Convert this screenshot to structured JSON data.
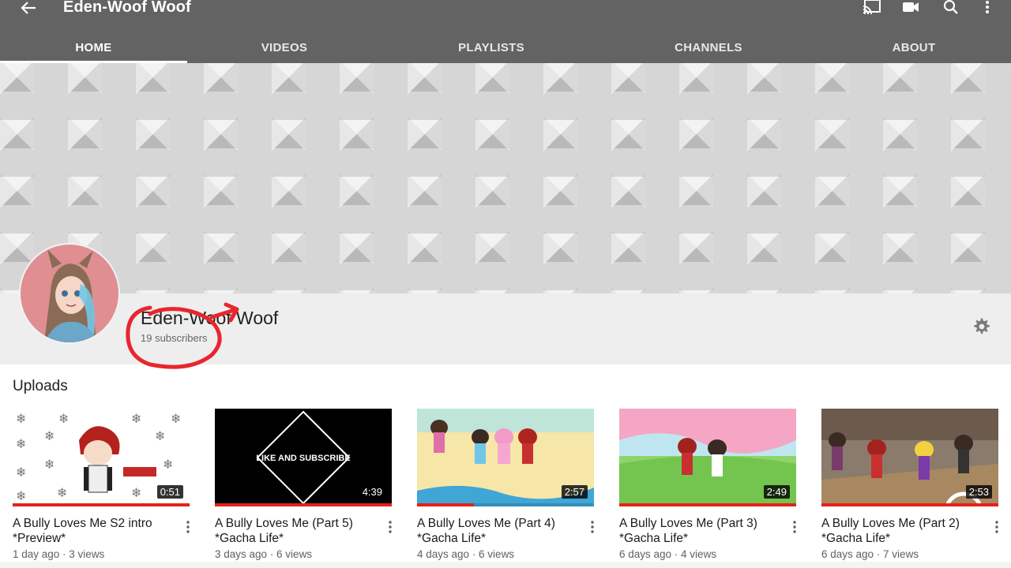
{
  "app": {
    "channel_title": "Eden-Woof Woof",
    "icons": [
      "back-arrow-icon",
      "cast-icon",
      "video-camera-icon",
      "search-icon",
      "more-vert-icon"
    ]
  },
  "tabs": [
    {
      "label": "HOME",
      "active": true
    },
    {
      "label": "VIDEOS",
      "active": false
    },
    {
      "label": "PLAYLISTS",
      "active": false
    },
    {
      "label": "CHANNELS",
      "active": false
    },
    {
      "label": "ABOUT",
      "active": false
    }
  ],
  "channel": {
    "name": "Eden-Woof Woof",
    "subscribers": "19 subscribers",
    "settings_icon": "gear-icon"
  },
  "uploads": {
    "heading": "Uploads",
    "videos": [
      {
        "title": "A Bully Loves Me S2 intro *Preview*",
        "meta": "1 day ago · 3 views",
        "duration": "0:51",
        "watched": 1.0
      },
      {
        "title": "A Bully Loves Me (Part 5) *Gacha Life*",
        "meta": "3 days ago · 6 views",
        "duration": "4:39",
        "watched": 1.0,
        "thumb_text": "LIKE AND SUBSCRIBE"
      },
      {
        "title": "A Bully Loves Me (Part 4) *Gacha Life*",
        "meta": "4 days ago · 6 views",
        "duration": "2:57",
        "watched": 0.32
      },
      {
        "title": "A Bully Loves Me (Part 3) *Gacha Life*",
        "meta": "6 days ago · 4 views",
        "duration": "2:49",
        "watched": 1.0
      },
      {
        "title": "A Bully Loves Me (Part 2) *Gacha Life*",
        "meta": "6 days ago · 7 views",
        "duration": "2:53",
        "watched": 1.0
      }
    ]
  },
  "colors": {
    "appbar": "#636363",
    "progress": "#e62117",
    "annotation": "#e8262e"
  }
}
